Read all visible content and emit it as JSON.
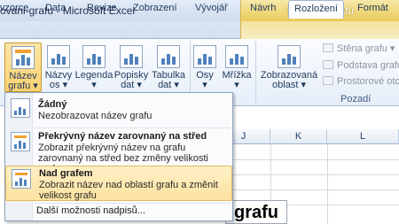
{
  "app": {
    "window_title": "ovani-grafu - Microsoft Excel",
    "context_title": "Nástroje grafu"
  },
  "tabs": [
    "vzorce",
    "Data",
    "Revize",
    "Zobrazení",
    "Vývojář",
    "Návrh",
    "Rozložení",
    "Formát"
  ],
  "active_tab": "Rozložení",
  "ribbon": {
    "buttons": [
      {
        "label1": "Název",
        "label2": "grafu ▾",
        "pressed": true
      },
      {
        "label1": "Názvy",
        "label2": "os ▾"
      },
      {
        "label1": "Legenda",
        "label2": "▾"
      },
      {
        "label1": "Popisky",
        "label2": "dat ▾"
      },
      {
        "label1": "Tabulka",
        "label2": "dat ▾"
      },
      {
        "label1": "Osy",
        "label2": "▾"
      },
      {
        "label1": "Mřížka",
        "label2": "▾"
      },
      {
        "label1": "Zobrazovaná",
        "label2": "oblast ▾"
      }
    ],
    "small_commands": [
      "Stěna grafu ▾",
      "Podstava grafu ▾",
      "Prostorové otoč"
    ],
    "group_label": "Pozadí"
  },
  "sheet": {
    "columns": [
      "J",
      "K",
      "L"
    ],
    "chart_title_fragment": "grafu"
  },
  "menu": {
    "items": [
      {
        "title": "Žádný",
        "desc": "Nezobrazovat název grafu",
        "highlighted": false
      },
      {
        "title": "Překrývný název zarovnaný na střed",
        "desc": "Zobrazit překrývný název na grafu zarovnaný na střed bez změny velikosti grafu",
        "highlighted": false
      },
      {
        "title": "Nad grafem",
        "desc": "Zobrazit název nad oblastí grafu a změnit velikost grafu",
        "highlighted": true
      }
    ],
    "more": "Další možnosti nadpisů..."
  },
  "colors": {
    "accent": "#4f81bd",
    "highlight": "#fde2a0",
    "context": "#eacb5a"
  }
}
